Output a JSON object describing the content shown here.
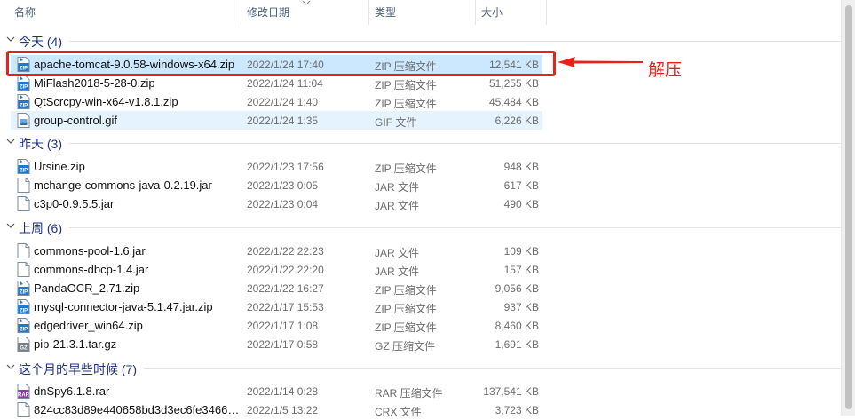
{
  "columns": {
    "name": "名称",
    "modified": "修改日期",
    "type": "类型",
    "size": "大小"
  },
  "groups": [
    {
      "label": "今天 (4)"
    },
    {
      "label": "昨天 (3)"
    },
    {
      "label": "上周 (6)"
    },
    {
      "label": "这个月的早些时候 (7)"
    }
  ],
  "files": [
    {
      "name": "apache-tomcat-9.0.58-windows-x64.zip",
      "date": "2022/1/24 17:40",
      "type": "ZIP 压缩文件",
      "size": "12,541 KB",
      "icon": "zip-icon"
    },
    {
      "name": "MiFlash2018-5-28-0.zip",
      "date": "2022/1/24 11:04",
      "type": "ZIP 压缩文件",
      "size": "51,255 KB",
      "icon": "zip-icon"
    },
    {
      "name": "QtScrcpy-win-x64-v1.8.1.zip",
      "date": "2022/1/24 1:40",
      "type": "ZIP 压缩文件",
      "size": "45,484 KB",
      "icon": "zip-icon"
    },
    {
      "name": "group-control.gif",
      "date": "2022/1/24 1:35",
      "type": "GIF 文件",
      "size": "6,226 KB",
      "icon": "image-icon"
    },
    {
      "name": "Ursine.zip",
      "date": "2022/1/23 17:56",
      "type": "ZIP 压缩文件",
      "size": "948 KB",
      "icon": "zip-icon"
    },
    {
      "name": "mchange-commons-java-0.2.19.jar",
      "date": "2022/1/23 0:05",
      "type": "JAR 文件",
      "size": "617 KB",
      "icon": "file-icon"
    },
    {
      "name": "c3p0-0.9.5.5.jar",
      "date": "2022/1/23 0:04",
      "type": "JAR 文件",
      "size": "490 KB",
      "icon": "file-icon"
    },
    {
      "name": "commons-pool-1.6.jar",
      "date": "2022/1/22 22:23",
      "type": "JAR 文件",
      "size": "109 KB",
      "icon": "file-icon"
    },
    {
      "name": "commons-dbcp-1.4.jar",
      "date": "2022/1/22 22:20",
      "type": "JAR 文件",
      "size": "157 KB",
      "icon": "file-icon"
    },
    {
      "name": "PandaOCR_2.71.zip",
      "date": "2022/1/22 16:27",
      "type": "ZIP 压缩文件",
      "size": "9,056 KB",
      "icon": "zip-icon"
    },
    {
      "name": "mysql-connector-java-5.1.47.jar.zip",
      "date": "2022/1/17 15:53",
      "type": "ZIP 压缩文件",
      "size": "937 KB",
      "icon": "zip-icon"
    },
    {
      "name": "edgedriver_win64.zip",
      "date": "2022/1/17 1:08",
      "type": "ZIP 压缩文件",
      "size": "8,460 KB",
      "icon": "zip-icon"
    },
    {
      "name": "pip-21.3.1.tar.gz",
      "date": "2022/1/17 0:58",
      "type": "GZ 压缩文件",
      "size": "1,691 KB",
      "icon": "gz-icon"
    },
    {
      "name": "dnSpy6.1.8.rar",
      "date": "2022/1/14 0:28",
      "type": "RAR 压缩文件",
      "size": "137,541 KB",
      "icon": "rar-icon"
    },
    {
      "name": "824cc83d89e440658bd3d3ec6fe3466…",
      "date": "2022/1/5 13:22",
      "type": "CRX 文件",
      "size": "3,723 KB",
      "icon": "file-icon"
    }
  ],
  "annotation": {
    "label": "解压",
    "color": "#e8221b"
  },
  "colors": {
    "selection": "#cce8ff",
    "hover": "#e5f3ff",
    "group_text": "#1e3287",
    "zip_blue": "#1e78d2"
  }
}
